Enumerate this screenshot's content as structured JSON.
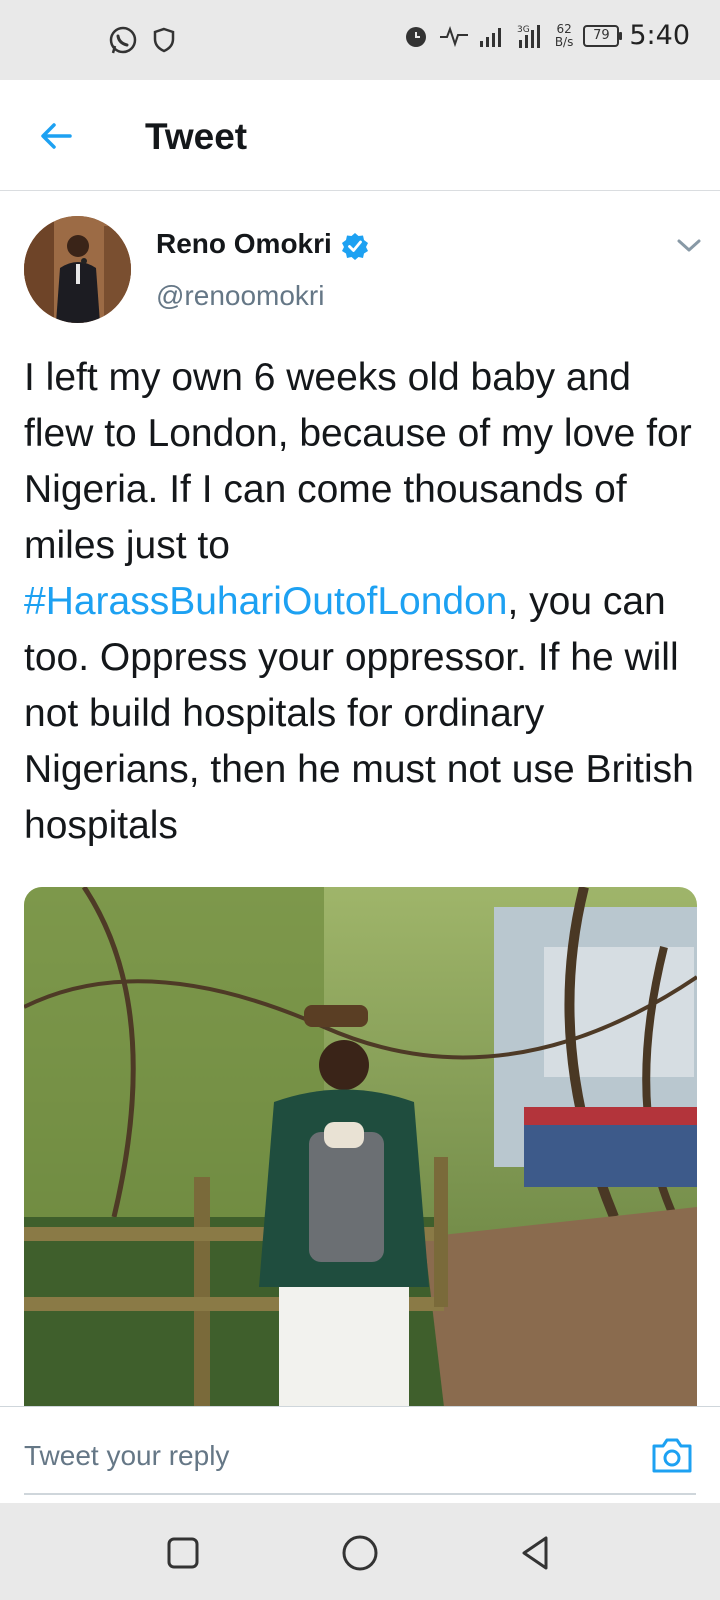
{
  "status_bar": {
    "time": "5:40",
    "battery": "79",
    "net_speed_value": "62",
    "net_speed_unit": "B/s",
    "icons": [
      "whatsapp-icon",
      "shield-icon",
      "alarm-icon",
      "activity-icon",
      "signal-icon",
      "signal-3g-icon"
    ]
  },
  "header": {
    "title": "Tweet",
    "back_icon": "arrow-left-icon"
  },
  "tweet": {
    "author_name": "Reno Omokri",
    "handle": "@renoomokri",
    "verified": true,
    "text_before": "I left my own 6 weeks old baby and flew to London, because of my love for Nigeria. If I can come thousands of miles just to ",
    "hashtag": "#HarassBuhariOutofLondon",
    "text_after": ", you can too. Oppress your oppressor. If he will not build hospitals for ordinary Nigerians, then he must not use British hospitals"
  },
  "reply": {
    "placeholder": "Tweet your reply",
    "camera_icon": "camera-icon"
  },
  "nav_bar": {
    "icons": [
      "recents-square-icon",
      "home-circle-icon",
      "back-triangle-icon"
    ]
  },
  "colors": {
    "accent": "#1da1f2",
    "secondary_text": "#657786",
    "bar_bg": "#e9e9e9"
  }
}
